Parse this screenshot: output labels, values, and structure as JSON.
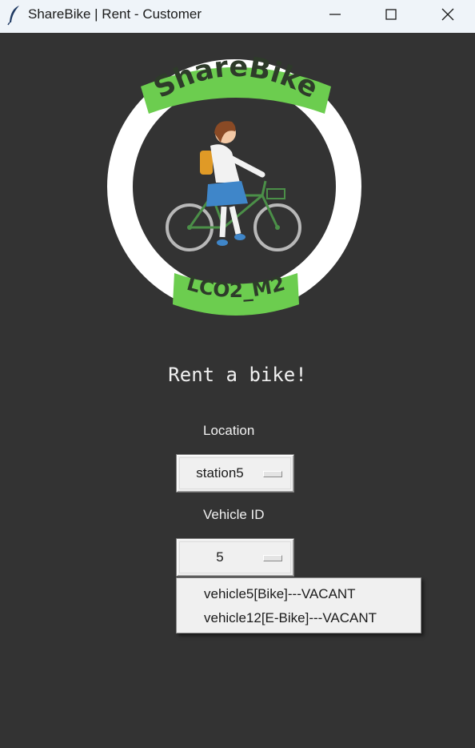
{
  "window": {
    "title": "ShareBike | Rent - Customer",
    "icon": "feather-icon",
    "controls": [
      "minimize-icon",
      "maximize-icon",
      "close-icon"
    ]
  },
  "logo": {
    "top_text": "ShareBike",
    "bottom_text": "LCO2_M2",
    "colors": {
      "ring": "#ffffff",
      "banner": "#6ccd4f",
      "banner_text": "#2e3b2a"
    }
  },
  "heading": "Rent a bike!",
  "location": {
    "label": "Location",
    "selected": "station5"
  },
  "vehicle": {
    "label": "Vehicle ID",
    "selected": "5",
    "options": [
      "vehicle5[Bike]---VACANT",
      "vehicle12[E-Bike]---VACANT"
    ]
  },
  "colors": {
    "background": "#333333",
    "titlebar": "#eff4f9"
  }
}
